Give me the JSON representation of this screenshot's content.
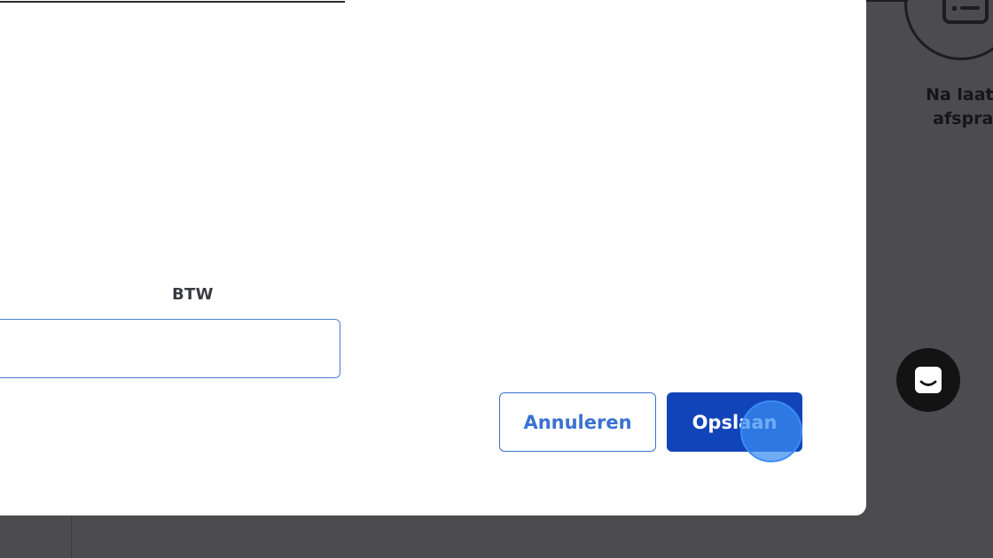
{
  "background": {
    "checklist_caption_line1": "Na laatste",
    "checklist_caption_line2": "afspraak",
    "checklist_icon": "checklist-icon",
    "chat_icon": "chat-icon"
  },
  "modal": {
    "btw_label": "BTW",
    "btw_input_value": "",
    "cancel_label": "Annuleren",
    "save_label": "Opslaan"
  },
  "colors": {
    "primary": "#1244b9",
    "outline_blue": "#3a72d1",
    "overlay": "#4c4c4e"
  }
}
